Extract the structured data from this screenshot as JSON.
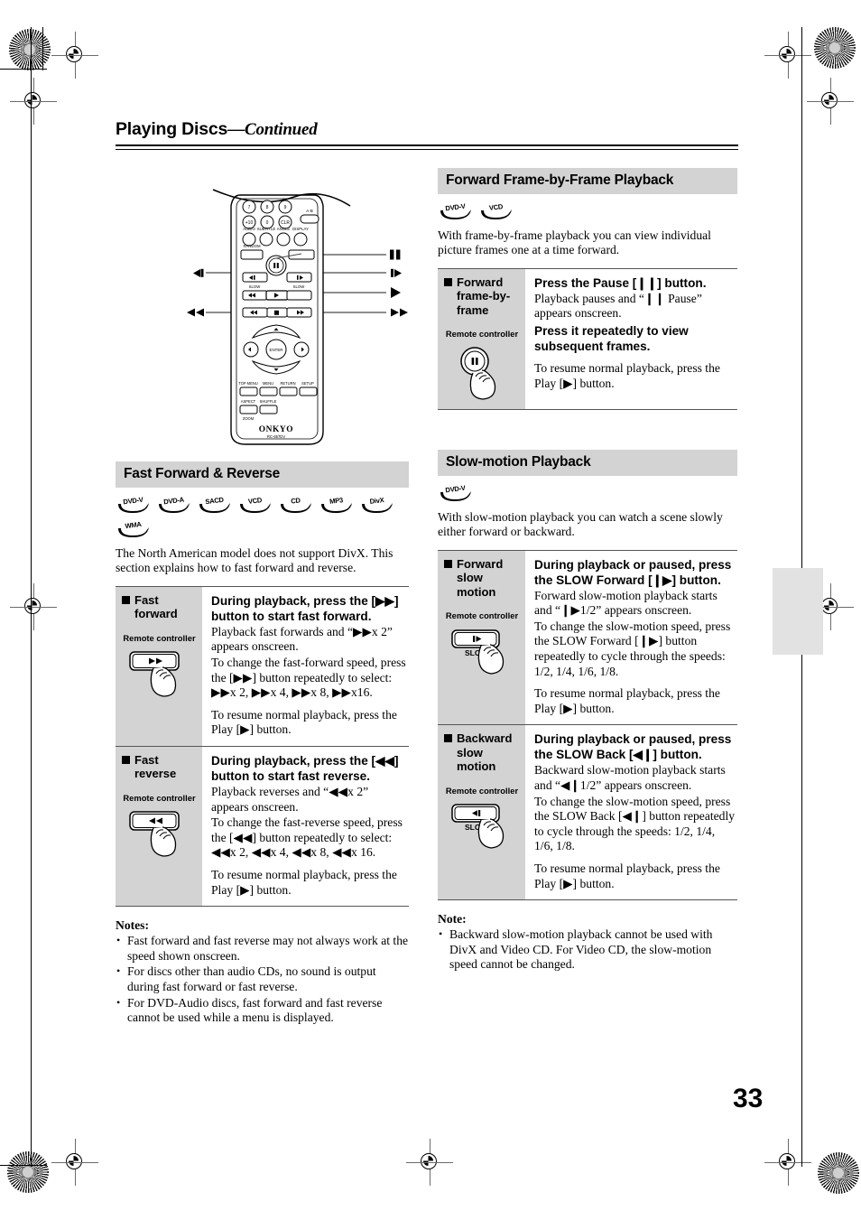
{
  "page": {
    "header_title": "Playing Discs",
    "header_suffix": "—Continued",
    "page_number": "33"
  },
  "remote": {
    "brand": "ONKYO",
    "model": "RC-657DV",
    "keypad": [
      "7",
      "8",
      "9",
      "+10",
      "0",
      "CLR"
    ],
    "function_labels": [
      "AUDIO",
      "SUBTITLE",
      "ANGLE",
      "DISPLAY"
    ],
    "random_label": "RANDOM",
    "ab_label": "A-B",
    "enter_label": "ENTER",
    "slow_label_left": "SLOW",
    "slow_label_right": "SLOW",
    "menu_labels": [
      "TOP MENU",
      "MENU",
      "RETURN",
      "SETUP"
    ],
    "extra_labels": [
      "ASPECT",
      "SHUFFLE",
      "ZOOM"
    ],
    "callouts": {
      "slow_back": "◀❙",
      "fast_reverse": "◀◀",
      "pause": "❙❙",
      "slow_forward": "❙▶",
      "play": "▶",
      "fast_forward": "▶▶"
    }
  },
  "left_column": {
    "section_title": "Fast Forward & Reverse",
    "badges": [
      "DVD-V",
      "DVD-A",
      "SACD",
      "VCD",
      "CD",
      "MP3",
      "DivX",
      "WMA"
    ],
    "intro": "The North American model does not support DivX. This section explains how to fast forward and reverse.",
    "rows": [
      {
        "label": "Fast forward",
        "remote_label": "Remote controller",
        "button_glyph": "▶▶",
        "heading": "During playback, press the [▶▶] button to start fast forward.",
        "paragraphs": [
          "Playback fast forwards and “▶▶x 2” appears onscreen.",
          "To change the fast-forward speed, press the [▶▶] button repeatedly to select: ▶▶x 2, ▶▶x 4, ▶▶x 8, ▶▶x16.",
          "To resume normal playback, press the Play [▶] button."
        ]
      },
      {
        "label": "Fast reverse",
        "remote_label": "Remote controller",
        "button_glyph": "◀◀",
        "heading": "During playback, press the [◀◀] button to start fast reverse.",
        "paragraphs": [
          "Playback reverses and “◀◀x 2” appears onscreen.",
          "To change the fast-reverse speed, press the [◀◀] button repeatedly to select: ◀◀x 2, ◀◀x 4, ◀◀x 8, ◀◀x 16.",
          "To resume normal playback, press the Play [▶] button."
        ]
      }
    ],
    "notes_title": "Notes:",
    "notes": [
      "Fast forward and fast reverse may not always work at the speed shown onscreen.",
      "For discs other than audio CDs, no sound is output during fast forward or fast reverse.",
      "For DVD-Audio discs, fast forward and fast reverse cannot be used while a menu is displayed."
    ]
  },
  "right_column": {
    "section1_title": "Forward Frame-by-Frame Playback",
    "section1_badges": [
      "DVD-V",
      "VCD"
    ],
    "section1_intro": "With frame-by-frame playback you can view individual picture frames one at a time forward.",
    "section1_rows": [
      {
        "label": "Forward frame-by-frame",
        "remote_label": "Remote controller",
        "heading1": "Press the Pause [❙❙] button.",
        "para1": "Playback pauses and “❙❙ Pause” appears onscreen.",
        "heading2": "Press it repeatedly to view subsequent frames.",
        "para2": "To resume normal playback, press the Play [▶] button."
      }
    ],
    "section2_title": "Slow-motion Playback",
    "section2_badges": [
      "DVD-V"
    ],
    "section2_intro": "With slow-motion playback you can watch a scene slowly either forward or backward.",
    "section2_rows": [
      {
        "label": "Forward slow motion",
        "remote_label": "Remote controller",
        "button_glyph": "❙▶",
        "button_sub": "SLOW",
        "heading": "During playback or paused, press the SLOW Forward [❙▶] button.",
        "paragraphs": [
          "Forward slow-motion playback starts and “❙▶1/2” appears onscreen.",
          "To change the slow-motion speed, press the SLOW Forward [❙▶] button repeatedly to cycle through the speeds: 1/2, 1/4, 1/6, 1/8.",
          "To resume normal playback, press the Play [▶] button."
        ]
      },
      {
        "label": "Backward slow motion",
        "remote_label": "Remote controller",
        "button_glyph": "◀❙",
        "button_sub": "SLOW",
        "heading": "During playback or paused, press the SLOW Back [◀❙] button.",
        "paragraphs": [
          "Backward slow-motion playback starts and “◀❙1/2” appears onscreen.",
          "To change the slow-motion speed, press the SLOW Back [◀❙] button repeatedly to cycle through the speeds: 1/2, 1/4, 1/6, 1/8.",
          "To resume normal playback, press the Play [▶] button."
        ]
      }
    ],
    "note_title": "Note:",
    "notes": [
      "Backward slow-motion playback cannot be used with DivX and Video CD. For Video CD, the slow-motion speed cannot be changed."
    ]
  }
}
